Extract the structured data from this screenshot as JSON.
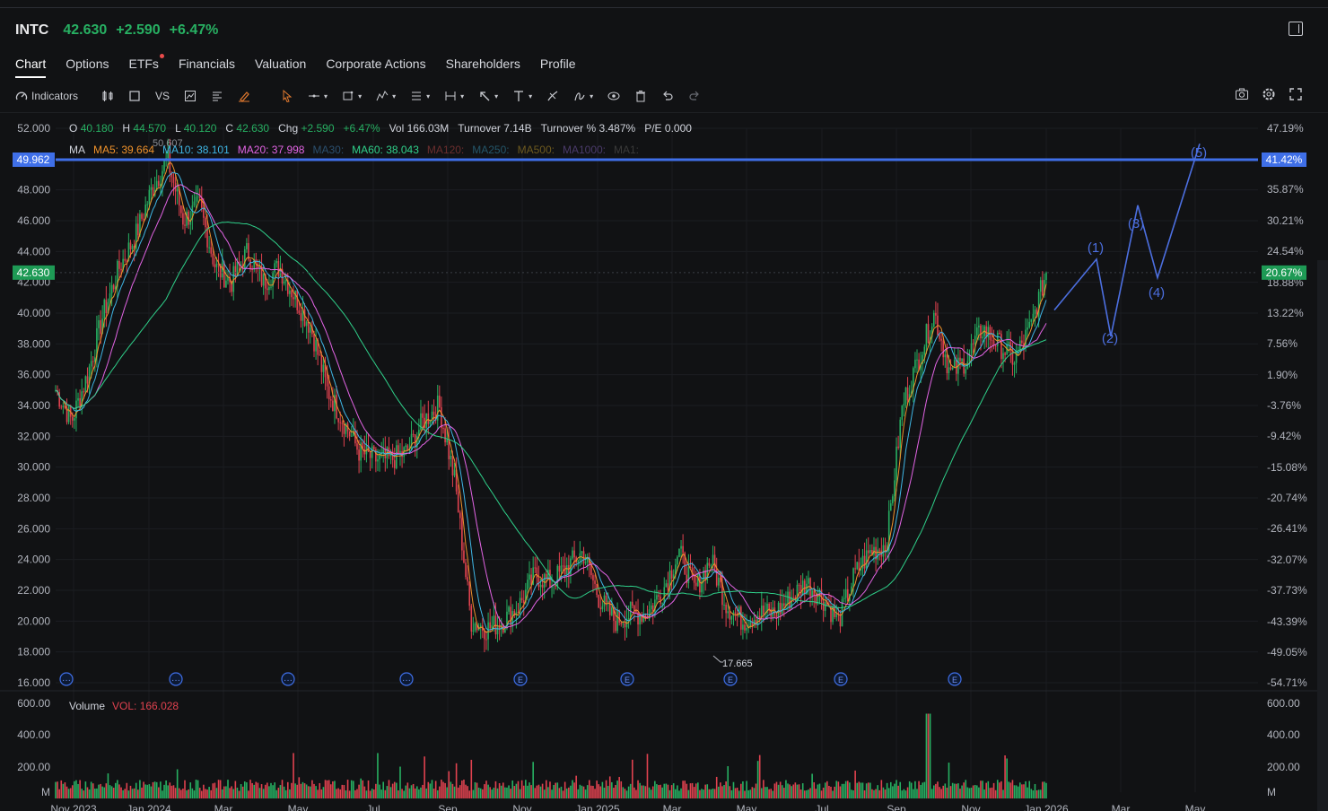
{
  "header": {
    "ticker": "INTC",
    "price": "42.630",
    "change": "+2.590",
    "change_pct": "+6.47%"
  },
  "tabs": [
    "Chart",
    "Options",
    "ETFs",
    "Financials",
    "Valuation",
    "Corporate Actions",
    "Shareholders",
    "Profile"
  ],
  "toolbar": {
    "indicators_label": "Indicators",
    "compare_label": "VS"
  },
  "ohlc": {
    "o_label": "O",
    "o": "40.180",
    "h_label": "H",
    "h": "44.570",
    "l_label": "L",
    "l": "40.120",
    "c_label": "C",
    "c": "42.630",
    "chg_label": "Chg",
    "chg": "+2.590",
    "chg_pct": "+6.47%",
    "vol_label": "Vol",
    "vol": "166.03M",
    "turnover_label": "Turnover",
    "turnover": "7.14B",
    "turnover_pct_label": "Turnover %",
    "turnover_pct": "3.487%",
    "pe_label": "P/E",
    "pe": "0.000"
  },
  "ma": {
    "label": "MA",
    "items": [
      {
        "text": "MA5: 39.664",
        "color": "#f0922b"
      },
      {
        "text": "MA10: 38.101",
        "color": "#3fb6e5"
      },
      {
        "text": "MA20: 37.998",
        "color": "#e264e4"
      },
      {
        "text": "MA30:",
        "color": "#2b4f6e"
      },
      {
        "text": "MA60: 38.043",
        "color": "#2fd08a"
      },
      {
        "text": "MA120:",
        "color": "#6b2e2e"
      },
      {
        "text": "MA250:",
        "color": "#24566a"
      },
      {
        "text": "MA500:",
        "color": "#6e5a1f"
      },
      {
        "text": "MA1000:",
        "color": "#4a3a6a"
      },
      {
        "text": "MA1:",
        "color": "#3a3a3a"
      }
    ]
  },
  "volume": {
    "label": "Volume",
    "vol_text": "VOL: 166.028"
  },
  "colors": {
    "up": "#27b062",
    "down": "#e0424f",
    "hline": "#3f6fe8",
    "wave": "#4c6fe0"
  },
  "chart_data": {
    "type": "candlestick",
    "price_axis": [
      "52.000",
      "50.000",
      "48.000",
      "46.000",
      "44.000",
      "42.000",
      "40.000",
      "38.000",
      "36.000",
      "34.000",
      "32.000",
      "30.000",
      "28.000",
      "26.000",
      "24.000",
      "22.000",
      "20.000",
      "18.000",
      "16.000"
    ],
    "pct_axis": [
      "47.19%",
      "35.87%",
      "30.21%",
      "24.54%",
      "18.88%",
      "13.22%",
      "7.56%",
      "1.90%",
      "-3.76%",
      "-9.42%",
      "-15.08%",
      "-20.74%",
      "-26.41%",
      "-32.07%",
      "-37.73%",
      "-43.39%",
      "-49.05%",
      "-54.71%"
    ],
    "ylim": [
      16,
      52
    ],
    "x_labels": [
      "Nov 2023",
      "Jan 2024",
      "Mar",
      "May",
      "Jul",
      "Sep",
      "Nov",
      "Jan 2025",
      "Mar",
      "May",
      "Jul",
      "Sep",
      "Nov",
      "Jan 2026",
      "Mar",
      "May"
    ],
    "close_path": [
      35,
      33,
      36,
      40,
      43,
      45,
      48,
      50,
      46,
      47,
      43,
      42,
      44,
      42,
      43,
      41,
      39,
      35,
      33,
      31,
      30.5,
      30.5,
      31,
      33,
      34,
      29,
      20,
      19.5,
      20,
      21,
      23,
      22.5,
      23.5,
      24.5,
      21.5,
      20,
      20.5,
      20.5,
      22,
      24.5,
      22,
      24,
      21,
      20,
      20.5,
      20.5,
      21.5,
      22.5,
      21.5,
      20,
      23,
      24.5,
      25,
      34,
      37,
      40,
      36,
      37,
      39,
      38,
      37,
      39,
      42.63
    ],
    "high_marker": "50.607",
    "low_marker": "17.665",
    "hline_value": "49.962",
    "hline_pct": "41.42%",
    "current_value": "42.630",
    "current_pct": "20.67%",
    "wave_labels": [
      "(1)",
      "(2)",
      "(3)",
      "(4)",
      "(5)"
    ],
    "wave_points": [
      [
        40.2,
        0
      ],
      [
        43.5,
        1
      ],
      [
        38.5,
        2
      ],
      [
        47.0,
        3
      ],
      [
        42.3,
        4
      ],
      [
        51.0,
        5
      ]
    ],
    "volume_axis": [
      "600.00",
      "400.00",
      "200.00",
      "M"
    ],
    "event_markers": [
      "dots",
      "dots",
      "dots",
      "dots",
      "E",
      "E",
      "E",
      "E",
      "E"
    ]
  }
}
